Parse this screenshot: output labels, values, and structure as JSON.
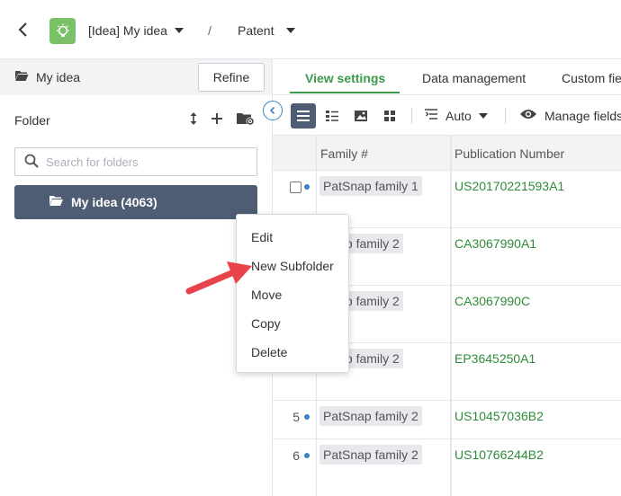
{
  "topbar": {
    "workspace_label": "[Idea] My idea",
    "separator": "/",
    "section_label": "Patent"
  },
  "left_panel": {
    "title": "My idea",
    "refine_label": "Refine",
    "folder_label": "Folder",
    "search_placeholder": "Search for folders",
    "selected_folder": "My idea (4063)"
  },
  "tabs": [
    {
      "label": "View settings",
      "active": true
    },
    {
      "label": "Data management",
      "active": false
    },
    {
      "label": "Custom fie",
      "active": false
    }
  ],
  "toolbar": {
    "auto_label": "Auto",
    "manage_fields_label": "Manage fields"
  },
  "grid": {
    "columns": [
      "Family #",
      "Publication Number"
    ],
    "rows": [
      {
        "num": "",
        "family": "PatSnap family 1",
        "publication": "US20170221593A1"
      },
      {
        "num": "",
        "family": "Snap family 2",
        "publication": "CA3067990A1"
      },
      {
        "num": "",
        "family": "Snap family 2",
        "publication": "CA3067990C"
      },
      {
        "num": "",
        "family": "Snap family 2",
        "publication": "EP3645250A1"
      },
      {
        "num": "5",
        "family": "PatSnap family 2",
        "publication": "US10457036B2"
      },
      {
        "num": "6",
        "family": "PatSnap family 2",
        "publication": "US10766244B2"
      }
    ]
  },
  "context_menu": {
    "items": [
      "Edit",
      "New Subfolder",
      "Move",
      "Copy",
      "Delete"
    ]
  },
  "colors": {
    "accent_green": "#3a9a4a",
    "folder_selected_bg": "#4e5d73",
    "link_green": "#2e8b3a",
    "arrow_red": "#e8424a",
    "idea_logo_green": "#79c066"
  }
}
